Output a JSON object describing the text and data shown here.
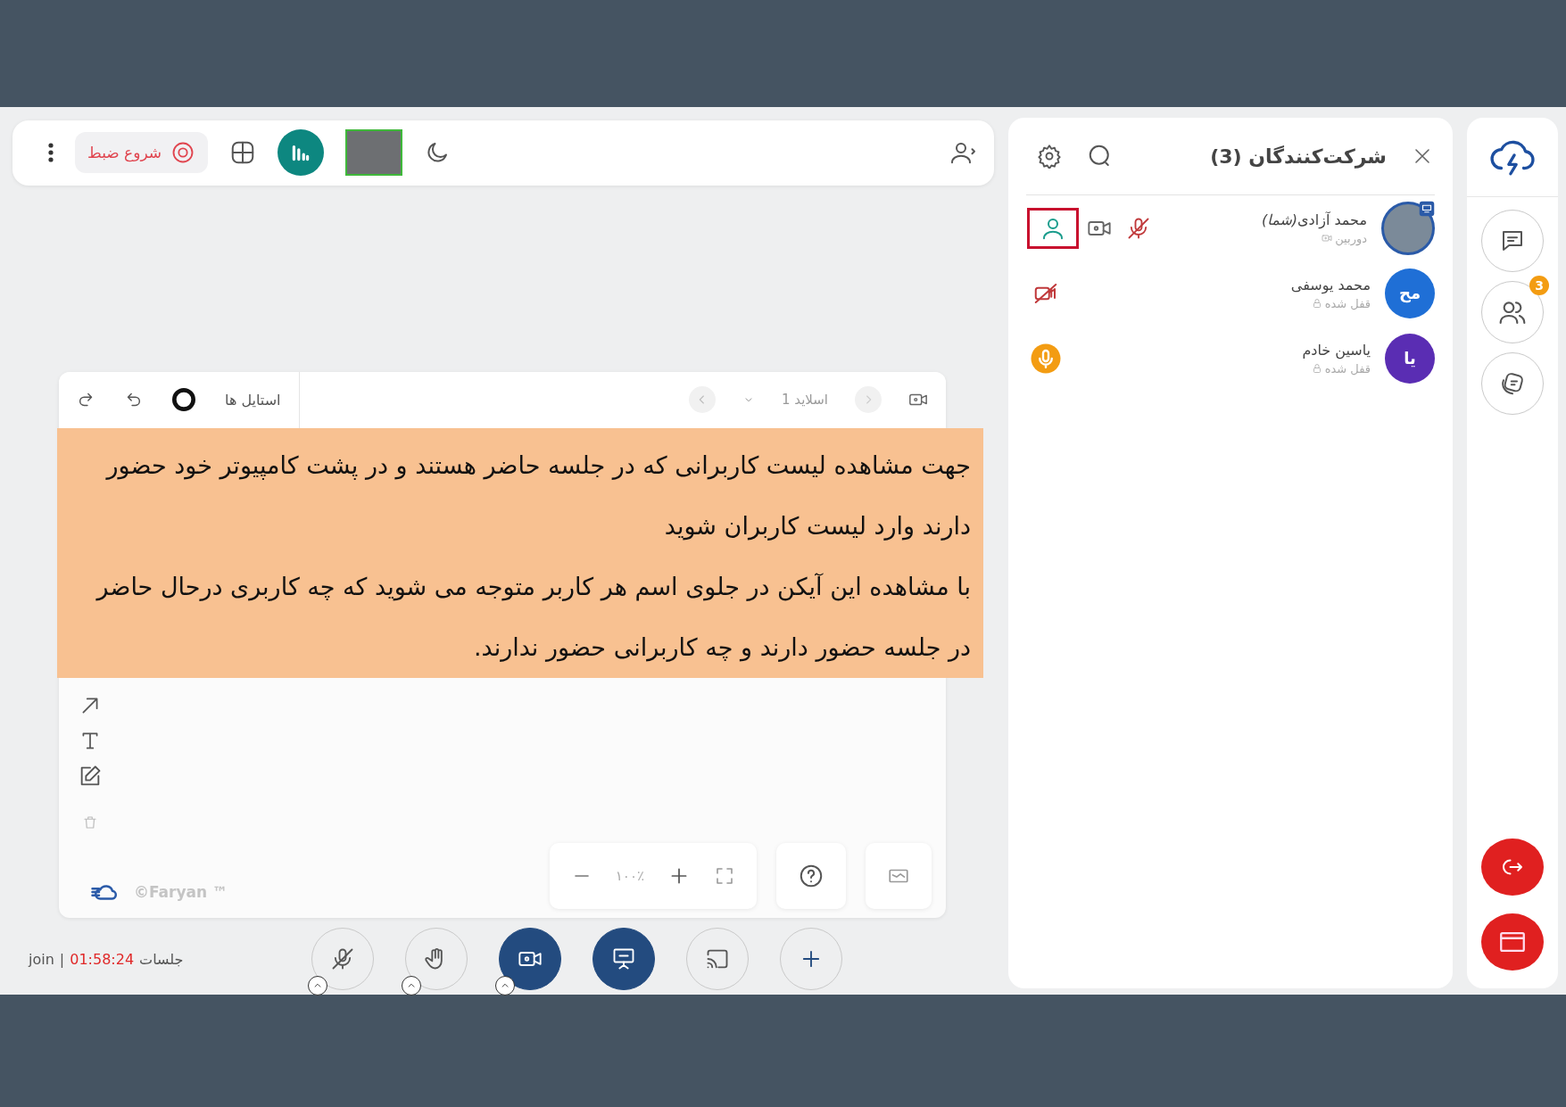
{
  "top_bar": {
    "record_button": {
      "label": "شروع ضبط"
    },
    "video_tile": {
      "speaking": true
    }
  },
  "whiteboard": {
    "styles_label": "استایل ها",
    "slide_label": "اسلاید 1",
    "zoom_reading": "۱۰۰٪",
    "brand": "©Faryan ™"
  },
  "tutorial_note": {
    "paragraphs": [
      "جهت مشاهده لیست کاربرانی که در جلسه حاضر هستند و در پشت کامپیوتر خود حضور دارند وارد لیست کاربران شوید",
      "با مشاهده این آیکن در جلوی اسم هر کاربر متوجه می شوید که چه کاربری درحال حاضر در جلسه حضور دارند و چه کاربرانی حضور ندارند."
    ]
  },
  "session_status": {
    "label": "جلسات",
    "timer": "01:58:24",
    "separator": "|",
    "mode": "join"
  },
  "controls": [
    {
      "kind": "mic",
      "on": false,
      "menu": true
    },
    {
      "kind": "hand",
      "on": false,
      "menu": true
    },
    {
      "kind": "camera",
      "on": true,
      "menu": true
    },
    {
      "kind": "present",
      "on": true,
      "menu": false
    },
    {
      "kind": "cast",
      "on": false,
      "menu": false
    },
    {
      "kind": "add",
      "on": false,
      "menu": false
    }
  ],
  "participants_panel": {
    "title": "شرکت‌کنندگان (3)",
    "participants": [
      {
        "name": "محمد آزادی",
        "you_tag": "(شما)",
        "status": {
          "kind": "camera",
          "text": "دوربین"
        },
        "avatar": {
          "kind": "photo"
        },
        "indicators": [
          {
            "kind": "presence",
            "highlighted": true
          },
          {
            "kind": "camera",
            "highlighted": false
          },
          {
            "kind": "mic_off",
            "highlighted": false
          }
        ]
      },
      {
        "name": "محمد یوسفی",
        "status": {
          "kind": "locked",
          "text": "قفل شده"
        },
        "avatar": {
          "kind": "initials",
          "initials": "مح",
          "color": "#1f6fd6"
        },
        "indicators": [
          {
            "kind": "cam_off",
            "highlighted": false
          }
        ]
      },
      {
        "name": "یاسین خادم",
        "status": {
          "kind": "locked",
          "text": "قفل شده"
        },
        "avatar": {
          "kind": "initials",
          "initials": "یا",
          "color": "#5a2db3"
        },
        "indicators": [
          {
            "kind": "speaking",
            "highlighted": false
          }
        ]
      }
    ]
  },
  "sidebar": {
    "participants_badge": "3"
  }
}
